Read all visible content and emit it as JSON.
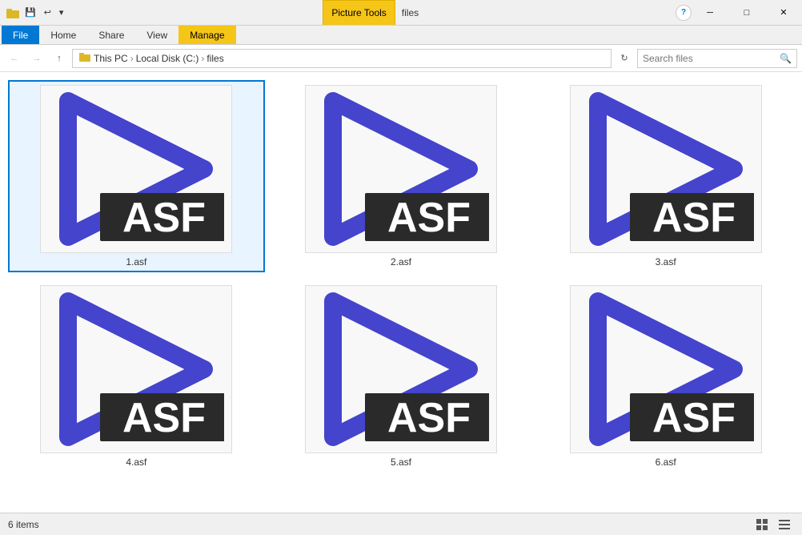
{
  "titlebar": {
    "picture_tools_label": "Picture Tools",
    "title_text": "files",
    "minimize_label": "─",
    "maximize_label": "□",
    "close_label": "✕"
  },
  "ribbon": {
    "tabs": [
      {
        "id": "file",
        "label": "File",
        "active": false,
        "style": "file"
      },
      {
        "id": "home",
        "label": "Home",
        "active": false,
        "style": "normal"
      },
      {
        "id": "share",
        "label": "Share",
        "active": false,
        "style": "normal"
      },
      {
        "id": "view",
        "label": "View",
        "active": false,
        "style": "normal"
      },
      {
        "id": "manage",
        "label": "Manage",
        "active": true,
        "style": "manage"
      }
    ]
  },
  "addressbar": {
    "back_title": "Back",
    "forward_title": "Forward",
    "up_title": "Up",
    "path": {
      "this_pc": "This PC",
      "local_disk": "Local Disk (C:)",
      "folder": "files"
    },
    "search_placeholder": "Search files"
  },
  "files": [
    {
      "id": "1",
      "name": "1.asf",
      "selected": true
    },
    {
      "id": "2",
      "name": "2.asf",
      "selected": false
    },
    {
      "id": "3",
      "name": "3.asf",
      "selected": false
    },
    {
      "id": "4",
      "name": "4.asf",
      "selected": false
    },
    {
      "id": "5",
      "name": "5.asf",
      "selected": false
    },
    {
      "id": "6",
      "name": "6.asf",
      "selected": false
    }
  ],
  "statusbar": {
    "items_count": "6 items"
  },
  "colors": {
    "play_arrow_stroke": "#3d3dc8",
    "play_arrow_fill": "#5050e0",
    "asf_bg": "#2a2a2a",
    "asf_text": "#ffffff",
    "selected_border": "#0078d4",
    "ribbon_manage_bg": "#f5c518"
  }
}
